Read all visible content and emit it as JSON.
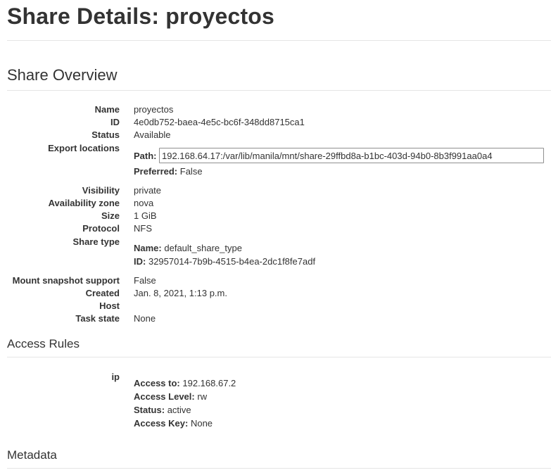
{
  "page_title": "Share Details: proyectos",
  "overview": {
    "heading": "Share Overview",
    "fields": {
      "name_label": "Name",
      "name_value": "proyectos",
      "id_label": "ID",
      "id_value": "4e0db752-baea-4e5c-bc6f-348dd8715ca1",
      "status_label": "Status",
      "status_value": "Available",
      "export_label": "Export locations",
      "path_label": "Path:",
      "path_value": "192.168.64.17:/var/lib/manila/mnt/share-29ffbd8a-b1bc-403d-94b0-8b3f991aa0a4",
      "preferred_label": "Preferred:",
      "preferred_value": "False",
      "visibility_label": "Visibility",
      "visibility_value": "private",
      "az_label": "Availability zone",
      "az_value": "nova",
      "size_label": "Size",
      "size_value": "1 GiB",
      "protocol_label": "Protocol",
      "protocol_value": "NFS",
      "share_type_label": "Share type",
      "st_name_label": "Name:",
      "st_name_value": "default_share_type",
      "st_id_label": "ID:",
      "st_id_value": "32957014-7b9b-4515-b4ea-2dc1f8fe7adf",
      "mount_label": "Mount snapshot support",
      "mount_value": "False",
      "created_label": "Created",
      "created_value": "Jan. 8, 2021, 1:13 p.m.",
      "host_label": "Host",
      "host_value": "",
      "task_label": "Task state",
      "task_value": "None"
    }
  },
  "access_rules": {
    "heading": "Access Rules",
    "rule_type": "ip",
    "access_to_label": "Access to:",
    "access_to_value": "192.168.67.2",
    "access_level_label": "Access Level:",
    "access_level_value": "rw",
    "status_label": "Status:",
    "status_value": "active",
    "access_key_label": "Access Key:",
    "access_key_value": "None"
  },
  "metadata": {
    "heading": "Metadata"
  }
}
